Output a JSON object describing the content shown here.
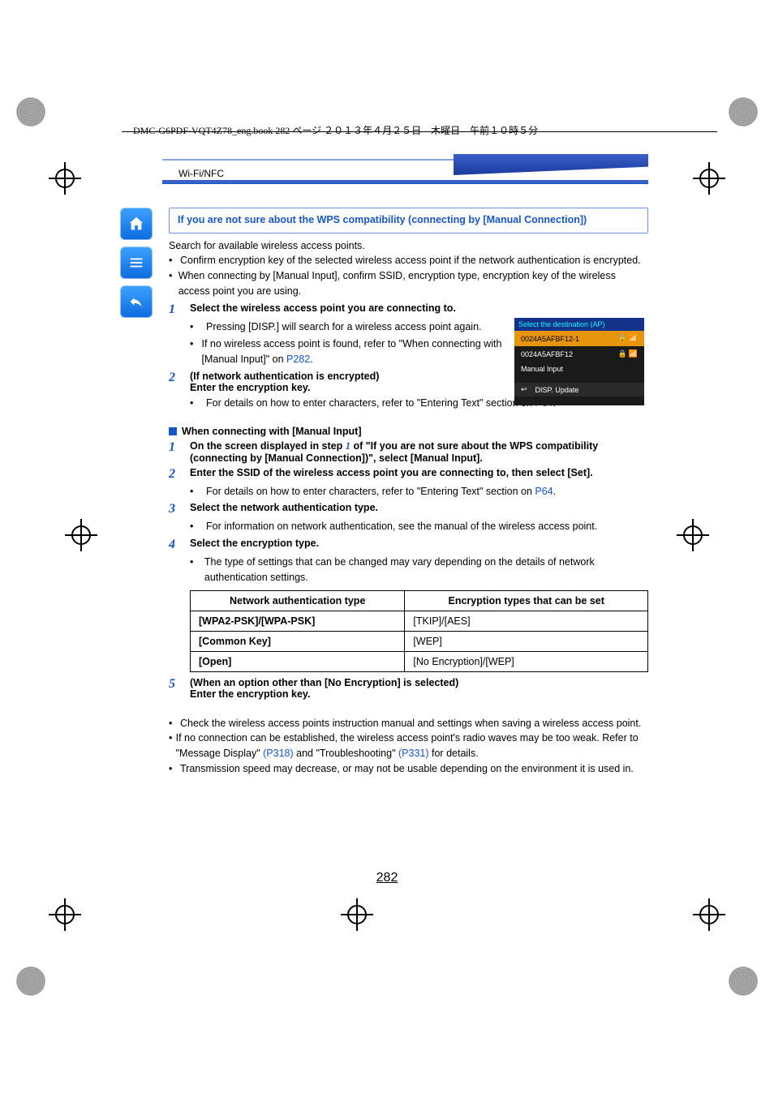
{
  "meta_header": "DMC-G6PDF-VQT4Z78_eng.book  282 ページ  ２０１３年４月２５日　木曜日　午前１０時５分",
  "breadcrumb": "Wi-Fi/NFC",
  "bluebox": "If you are not sure about the WPS compatibility (connecting by [Manual Connection])",
  "intro1": "Search for available wireless access points.",
  "intro_b1": "Confirm encryption key of the selected wireless access point if the network authentication is encrypted.",
  "intro_b2": "When connecting by [Manual Input], confirm SSID, encryption type, encryption key of the wireless access point you are using.",
  "step1": {
    "title": "Select the wireless access point you are connecting to.",
    "sub1": "Pressing [DISP.] will search for a wireless access point again.",
    "sub2_a": "If no wireless access point is found, refer to \"When connecting with [Manual Input]\" on ",
    "sub2_link": "P282",
    "sub2_b": "."
  },
  "step2": {
    "title_a": "(If network authentication is encrypted)",
    "title_b": "Enter the encryption key.",
    "sub1_a": "For details on how to enter characters, refer to \"Entering Text\" section on ",
    "sub1_link": "P64",
    "sub1_b": "."
  },
  "section2_title": "When connecting with [Manual Input]",
  "s2_step1": "On the screen displayed in step 1 of \"If you are not sure about the WPS compatibility (connecting by [Manual Connection])\", select [Manual Input].",
  "s2_step1_pre": "On the screen displayed in step ",
  "s2_step1_num": "1",
  "s2_step1_post": " of \"If you are not sure about the WPS compatibility (connecting by [Manual Connection])\", select [Manual Input].",
  "s2_step2": {
    "title": "Enter the SSID of the wireless access point you are connecting to, then select [Set].",
    "sub1_a": "For details on how to enter characters, ",
    "sub1_mid": "refer to \"Entering Text\" section on ",
    "sub1_link": "P64",
    "sub1_b": "."
  },
  "s2_step3": {
    "title": "Select the network authentication type.",
    "sub1": "For information on network authentication, see the manual of the wireless access point."
  },
  "s2_step4": {
    "title": "Select the encryption type.",
    "sub1": "The type of settings that can be changed may vary depending on the details of network authentication settings."
  },
  "table": {
    "h1": "Network authentication type",
    "h2": "Encryption types that can be set",
    "rows": [
      [
        "[WPA2-PSK]/[WPA-PSK]",
        "[TKIP]/[AES]"
      ],
      [
        "[Common Key]",
        "[WEP]"
      ],
      [
        "[Open]",
        "[No Encryption]/[WEP]"
      ]
    ]
  },
  "s2_step5": {
    "title_a": "(When an option other than [No Encryption] is selected)",
    "title_b": "Enter the encryption key."
  },
  "notes": {
    "n1": "Check the wireless access points instruction manual and settings when saving a wireless access point.",
    "n2_a": "If no connection can be established, the wireless access point's radio waves may be too weak. Refer to \"Message Display\" ",
    "n2_l1": "(P318)",
    "n2_b": " and \"Troubleshooting\" ",
    "n2_l2": "(P331)",
    "n2_c": " for details.",
    "n3": "Transmission speed may decrease, or may not be usable depending on the environment it is used in."
  },
  "pagenum": "282",
  "ss": {
    "header": "Select the destination (AP)",
    "r1": "0024A5AFBF12-1",
    "r2": "0024A5AFBF12",
    "r3": "Manual Input",
    "disp": "DISP. Update"
  }
}
